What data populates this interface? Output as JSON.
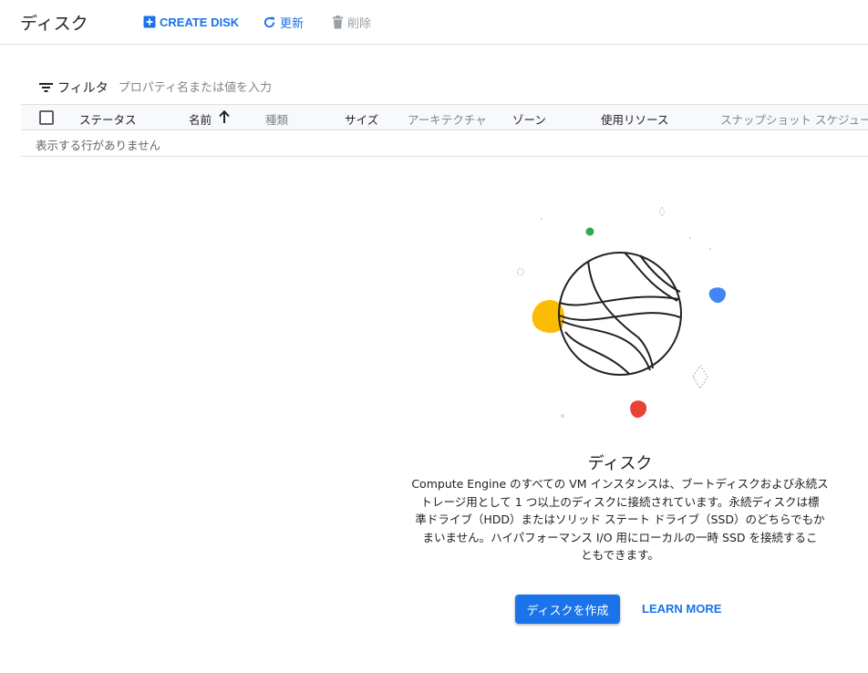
{
  "header": {
    "title": "ディスク",
    "create_label": "CREATE DISK",
    "refresh_label": "更新",
    "delete_label": "削除"
  },
  "filter": {
    "label": "フィルタ",
    "placeholder": "プロパティ名または値を入力"
  },
  "table": {
    "columns": [
      "ステータス",
      "名前",
      "種類",
      "サイズ",
      "アーキテクチャ",
      "ゾーン",
      "使用リソース",
      "スナップショット スケジュール"
    ],
    "sorted_column": "名前",
    "empty_message": "表示する行がありません"
  },
  "empty_state": {
    "title": "ディスク",
    "description_lines": [
      "Compute Engine のすべての VM インスタンスは、ブートディスクおよび永続ス",
      "トレージ用として 1 つ以上のディスクに接続されています。永続ディスクは標",
      "準ドライブ（HDD）またはソリッド ステート ドライブ（SSD）のどちらでもか",
      "まいません。ハイパフォーマンス I/O 用にローカルの一時 SSD を接続するこ",
      "ともできます。"
    ],
    "primary_button": "ディスクを作成",
    "secondary_link": "LEARN MORE"
  },
  "colors": {
    "accent": "#1a73e8",
    "muted_text": "#80868b",
    "illustration_yellow": "#fbbc04",
    "illustration_blue": "#4285f4",
    "illustration_red": "#ea4335",
    "illustration_green": "#34a853"
  },
  "icons": {
    "create": "add-box-icon",
    "refresh": "refresh-icon",
    "delete": "trash-icon",
    "filter": "filter-list-icon",
    "sort": "arrow-upward-icon"
  }
}
